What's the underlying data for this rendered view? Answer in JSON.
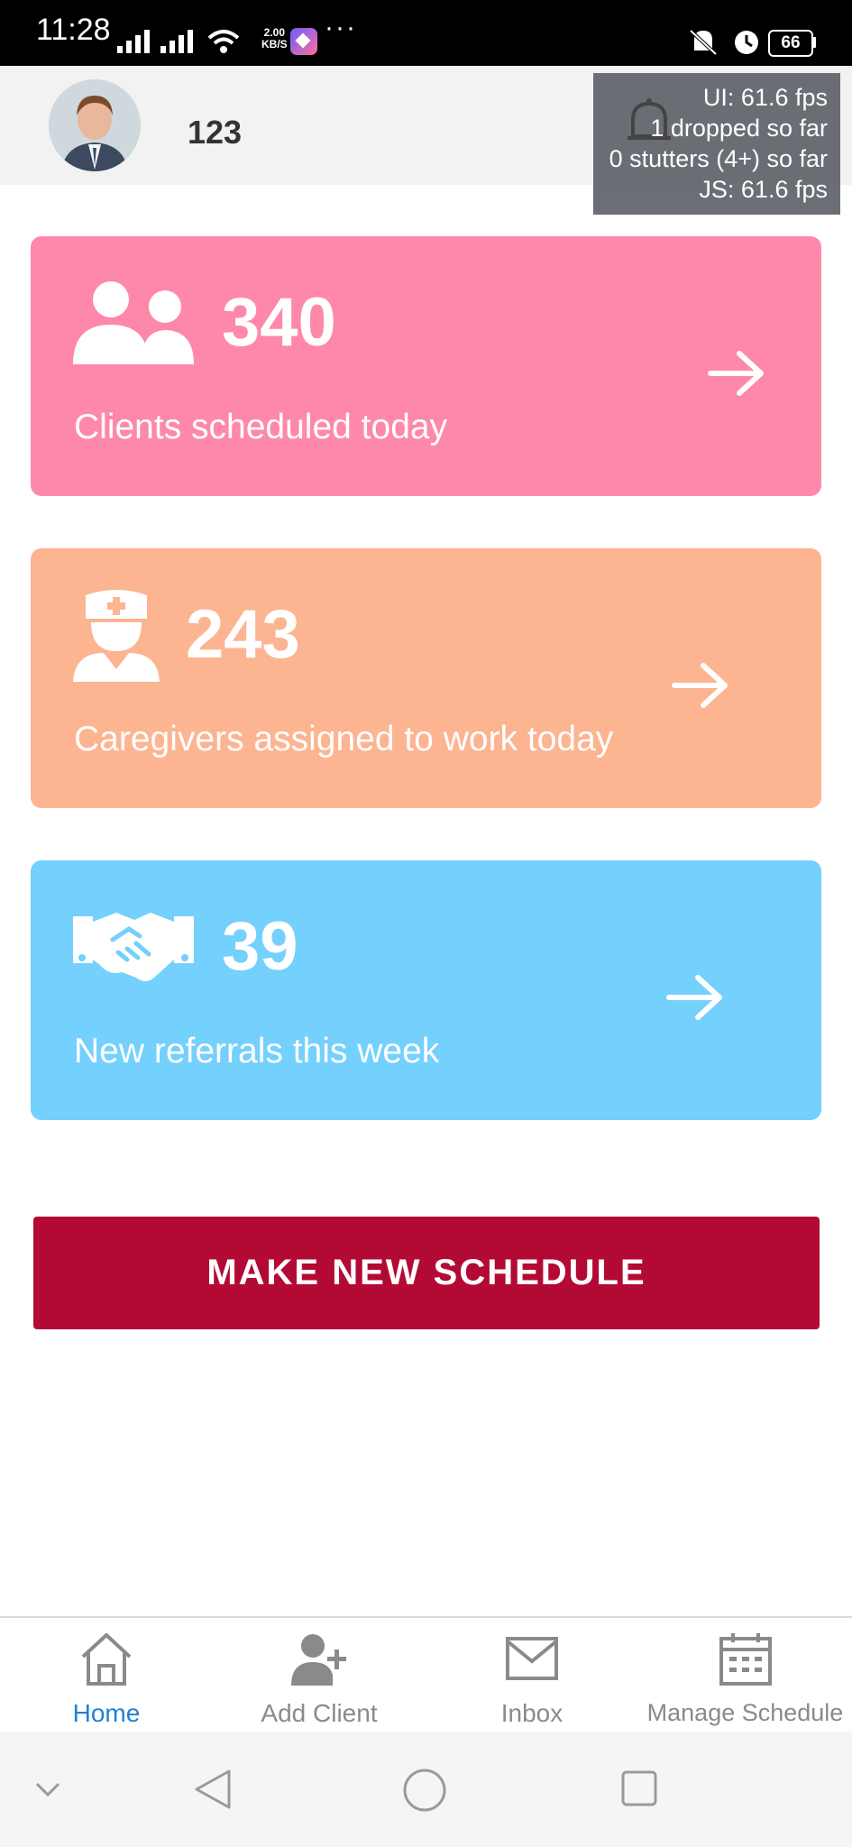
{
  "status_bar": {
    "time": "11:28",
    "net_speed_value": "2.00",
    "net_speed_unit": "KB/S",
    "more_indicator": "···",
    "battery": "66"
  },
  "header": {
    "user_name": "123"
  },
  "perf_monitor": {
    "ui_fps": "UI: 61.6 fps",
    "dropped": "1 dropped so far",
    "stutters": "0 stutters (4+) so far",
    "js_fps": "JS: 61.6 fps"
  },
  "cards": [
    {
      "count": "340",
      "label": "Clients scheduled today",
      "color": "#fe88a9",
      "icon": "users-icon"
    },
    {
      "count": "243",
      "label": "Caregivers assigned to work today",
      "color": "#fcb491",
      "icon": "nurse-icon"
    },
    {
      "count": "39",
      "label": "New referrals this week",
      "color": "#74d0fc",
      "icon": "handshake-icon"
    }
  ],
  "primary_action": {
    "label": "MAKE NEW SCHEDULE",
    "color": "#b30a35"
  },
  "tabs": [
    {
      "label": "Home",
      "icon": "home-icon",
      "active": true
    },
    {
      "label": "Add Client",
      "icon": "add-user-icon",
      "active": false
    },
    {
      "label": "Inbox",
      "icon": "mail-icon",
      "active": false
    },
    {
      "label": "Manage Schedule",
      "icon": "calendar-icon",
      "active": false
    }
  ],
  "colors": {
    "active_tab": "#1f7fd6",
    "inactive_tab": "#8a8a8a"
  }
}
